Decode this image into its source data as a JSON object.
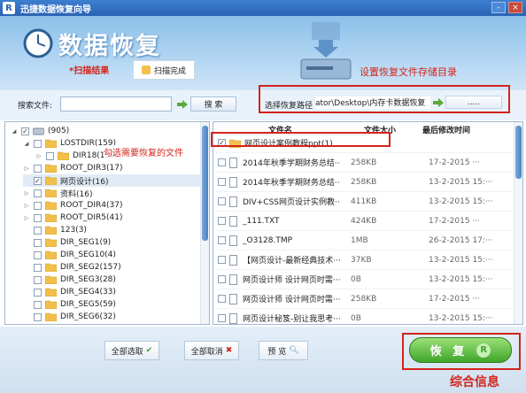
{
  "window": {
    "logo": "R",
    "title": "迅捷数据恢复向导",
    "buttons": [
      "-",
      "×"
    ]
  },
  "header": {
    "heading": "数据恢复",
    "scan_result": "*扫描结果",
    "scan_status": "扫描完成"
  },
  "annotations": {
    "set_path": "设置恢复文件存储目录",
    "select_files": "勾选需要恢复的文件"
  },
  "search": {
    "label": "搜索文件:",
    "value": "",
    "button": "搜 索"
  },
  "recovery_path": {
    "label": "选择恢复路径",
    "value": "ator\\Desktop\\内存卡数据恢复",
    "browse_button": "....."
  },
  "tree": {
    "items": [
      {
        "label": "(905)",
        "level": 0,
        "checked": true,
        "expander": "◢"
      },
      {
        "label": "LOSTDIR(159)",
        "level": 1,
        "checked": false,
        "expander": "◢"
      },
      {
        "label": "DIR18(159)",
        "level": 2,
        "checked": false,
        "expander": "▷"
      },
      {
        "label": "ROOT_DIR3(17)",
        "level": 1,
        "checked": false,
        "expander": "▷"
      },
      {
        "label": "网页设计(16)",
        "level": 1,
        "checked": true,
        "expander": "",
        "selected": true
      },
      {
        "label": "资料(16)",
        "level": 1,
        "checked": false,
        "expander": "▷"
      },
      {
        "label": "ROOT_DIR4(37)",
        "level": 1,
        "checked": false,
        "expander": "▷"
      },
      {
        "label": "ROOT_DIR5(41)",
        "level": 1,
        "checked": false,
        "expander": "▷"
      },
      {
        "label": "123(3)",
        "level": 1,
        "checked": false,
        "expander": ""
      },
      {
        "label": "DIR_SEG1(9)",
        "level": 1,
        "checked": false,
        "expander": ""
      },
      {
        "label": "DIR_SEG10(4)",
        "level": 1,
        "checked": false,
        "expander": ""
      },
      {
        "label": "DIR_SEG2(157)",
        "level": 1,
        "checked": false,
        "expander": ""
      },
      {
        "label": "DIR_SEG3(28)",
        "level": 1,
        "checked": false,
        "expander": ""
      },
      {
        "label": "DIR_SEG4(33)",
        "level": 1,
        "checked": false,
        "expander": ""
      },
      {
        "label": "DIR_SEG5(59)",
        "level": 1,
        "checked": false,
        "expander": ""
      },
      {
        "label": "DIR_SEG6(32)",
        "level": 1,
        "checked": false,
        "expander": ""
      }
    ]
  },
  "files": {
    "columns": {
      "name": "文件名",
      "size": "文件大小",
      "date": "最后修改时间"
    },
    "rows": [
      {
        "name": "网页设计案例教程ppt(1)",
        "size": "",
        "date": "",
        "checked": true,
        "folder": true
      },
      {
        "name": "2014年秋季学期财务总结···",
        "size": "258KB",
        "date": "17-2-2015 ···",
        "checked": false
      },
      {
        "name": "2014年秋季学期财务总结···",
        "size": "258KB",
        "date": "13-2-2015 15:···",
        "checked": false
      },
      {
        "name": "DIV+CSS网页设计实例教···",
        "size": "411KB",
        "date": "13-2-2015 15:···",
        "checked": false
      },
      {
        "name": "_111.TXT",
        "size": "424KB",
        "date": "17-2-2015 ···",
        "checked": false
      },
      {
        "name": "_O3128.TMP",
        "size": "1MB",
        "date": "26-2-2015 17:···",
        "checked": false
      },
      {
        "name": "【网页设计-最新经典技术···",
        "size": "37KB",
        "date": "13-2-2015 15:···",
        "checked": false
      },
      {
        "name": "网页设计师 设计网页时需···",
        "size": "0B",
        "date": "13-2-2015 15:···",
        "checked": false
      },
      {
        "name": "网页设计师 设计网页时需···",
        "size": "258KB",
        "date": "17-2-2015 ···",
        "checked": false
      },
      {
        "name": "网页设计秘笈-别让我思考···",
        "size": "0B",
        "date": "13-2-2015 15:···",
        "checked": false
      }
    ]
  },
  "bottom": {
    "select_all": "全部选取",
    "deselect_all": "全部取消",
    "preview": "预 览",
    "recover": "恢 复",
    "recover_logo": "R"
  },
  "watermark": "综合信息",
  "colors": {
    "accent": "#2a63b3",
    "annotation": "#d4231b",
    "recover": "#3fa52a"
  }
}
